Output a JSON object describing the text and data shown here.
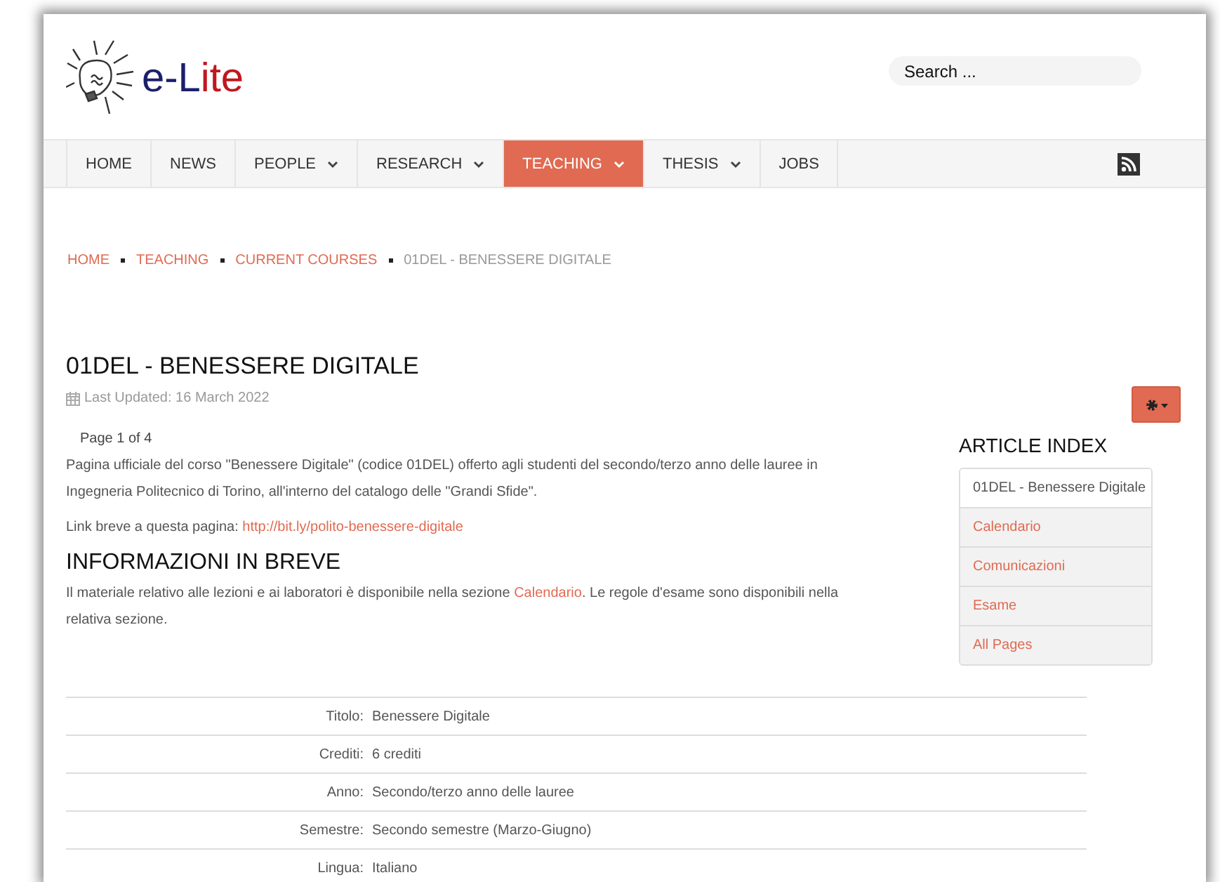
{
  "header": {
    "logo": [
      {
        "text": "e-L",
        "color": "#1c1f6b"
      },
      {
        "text": "ite",
        "color": "#c0171f"
      }
    ],
    "search": {
      "placeholder": "Search ..."
    }
  },
  "nav": [
    {
      "label": "HOME",
      "dropdown": false,
      "selected": false
    },
    {
      "label": "NEWS",
      "dropdown": false,
      "selected": false
    },
    {
      "label": "PEOPLE",
      "dropdown": true,
      "selected": false
    },
    {
      "label": "RESEARCH",
      "dropdown": true,
      "selected": false
    },
    {
      "label": "TEACHING",
      "dropdown": true,
      "selected": true
    },
    {
      "label": "THESIS",
      "dropdown": true,
      "selected": false
    },
    {
      "label": "JOBS",
      "dropdown": false,
      "selected": false
    }
  ],
  "breadcrumb": [
    {
      "label": "HOME",
      "current": false
    },
    {
      "label": "TEACHING",
      "current": false
    },
    {
      "label": "CURRENT COURSES",
      "current": false
    },
    {
      "label": "01DEL - BENESSERE DIGITALE",
      "current": true
    }
  ],
  "article": {
    "title": "01DEL - BENESSERE DIGITALE",
    "updated": "Last Updated: 16 March 2022",
    "page": "Page 1 of 4",
    "intro": "Pagina ufficiale del corso \"Benessere Digitale\" (codice 01DEL) offerto agli studenti del secondo/terzo anno delle lauree in Ingegneria Politecnico di Torino, all'interno del catalogo delle \"Grandi Sfide\".",
    "short_link": {
      "before": "Link breve a questa pagina: ",
      "link": "http://bit.ly/polito-benessere-digitale"
    },
    "section_title": "INFORMAZIONI IN BREVE",
    "section_text": {
      "before": "Il materiale relativo alle lezioni e ai laboratori è disponibile nella sezione ",
      "link": "Calendario",
      "after": ". Le regole d'esame sono disponibili nella relativa sezione."
    },
    "info_table": [
      {
        "label": "Titolo:",
        "value": "Benessere Digitale"
      },
      {
        "label": "Crediti:",
        "value": "6 crediti"
      },
      {
        "label": "Anno:",
        "value": "Secondo/terzo anno delle lauree"
      },
      {
        "label": "Semestre:",
        "value": "Secondo semestre (Marzo-Giugno)"
      },
      {
        "label": "Lingua:",
        "value": "Italiano"
      }
    ]
  },
  "article_index": {
    "title": "ARTICLE INDEX",
    "items": [
      {
        "label": "01DEL - Benessere Digitale",
        "selected": true
      },
      {
        "label": "Calendario",
        "selected": false
      },
      {
        "label": "Comunicazioni",
        "selected": false
      },
      {
        "label": "Esame",
        "selected": false
      },
      {
        "label": "All Pages",
        "selected": false
      }
    ]
  }
}
